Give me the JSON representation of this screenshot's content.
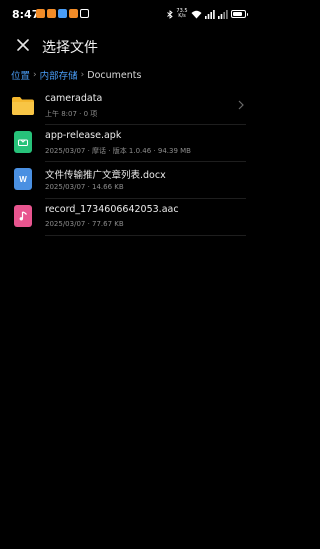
{
  "status_bar": {
    "time": "8:47",
    "notification_icons": [
      {
        "icon": "message-icon",
        "color": "#f28c28"
      },
      {
        "icon": "app-icon",
        "color": "#f28c28"
      },
      {
        "icon": "sync-icon",
        "color": "#4a9df6"
      },
      {
        "icon": "app-icon",
        "color": "#f28c28"
      },
      {
        "icon": "nfc-icon",
        "color": "#ffffff"
      }
    ],
    "speed_value": "73.5",
    "speed_unit": "K/s",
    "battery_level": 0.8
  },
  "header": {
    "title": "选择文件"
  },
  "breadcrumb": {
    "items": [
      "位置",
      "内部存储",
      "Documents"
    ]
  },
  "files": [
    {
      "name": "cameradata",
      "meta": "上午 8:07 · 0 项",
      "type": "folder",
      "icon": "folder-icon",
      "color": "#f5b82e"
    },
    {
      "name": "app-release.apk",
      "meta": "2025/03/07 · 摩话 · 版本 1.0.46 · 94.39 MB",
      "type": "apk",
      "icon": "apk-icon",
      "color": "#27c27a"
    },
    {
      "name": "文件传输推广文章列表.docx",
      "meta": "2025/03/07 · 14.66 KB",
      "type": "docx",
      "icon": "word-icon",
      "color": "#4a90e2"
    },
    {
      "name": "record_1734606642053.aac",
      "meta": "2025/03/07 · 77.67 KB",
      "type": "audio",
      "icon": "music-icon",
      "color": "#e8558f"
    }
  ]
}
